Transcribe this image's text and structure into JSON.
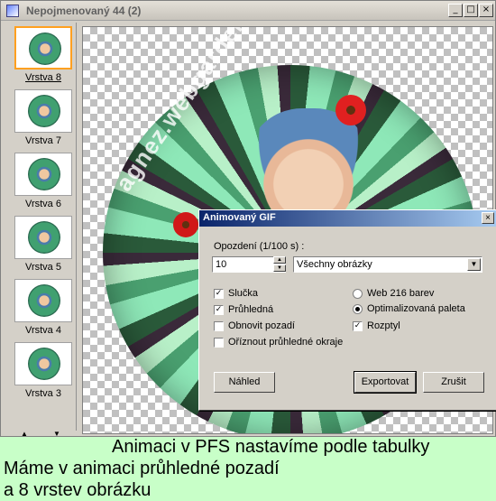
{
  "window": {
    "title": "Nepojmenovaný 44 (2)",
    "min": "_",
    "max": "□",
    "close": "×"
  },
  "layers": [
    {
      "label": "Vrstva 8",
      "selected": true
    },
    {
      "label": "Vrstva 7",
      "selected": false
    },
    {
      "label": "Vrstva 6",
      "selected": false
    },
    {
      "label": "Vrstva 5",
      "selected": false
    },
    {
      "label": "Vrstva 4",
      "selected": false
    },
    {
      "label": "Vrstva 3",
      "selected": false
    }
  ],
  "layer_scroll": {
    "up": "▲",
    "down": "▼"
  },
  "canvas": {
    "watermark": "agnez.webgarden.cz"
  },
  "dialog": {
    "title": "Animovaný GIF",
    "close": "×",
    "delay_label": "Opozdení (1/100 s) :",
    "delay_value": "10",
    "frames_select": "Všechny obrázky",
    "check_mark": "✓",
    "loop": "Slučka",
    "transparent": "Průhledná",
    "restore_bg": "Obnovit pozadí",
    "crop_transparent": "Oříznout průhledné okraje",
    "web216": "Web 216 barev",
    "optimized": "Optimalizovaná paleta",
    "dither": "Rozptyl",
    "preview_btn": "Náhled",
    "export_btn": "Exportovat",
    "cancel_btn": "Zrušit",
    "spin_up": "▲",
    "spin_down": "▼",
    "select_arrow": "▼"
  },
  "captions": {
    "line1": "Animaci v PFS nastavíme podle tabulky",
    "line2": "Máme v animaci průhledné pozadí",
    "line3": "a 8 vrstev obrázku"
  }
}
